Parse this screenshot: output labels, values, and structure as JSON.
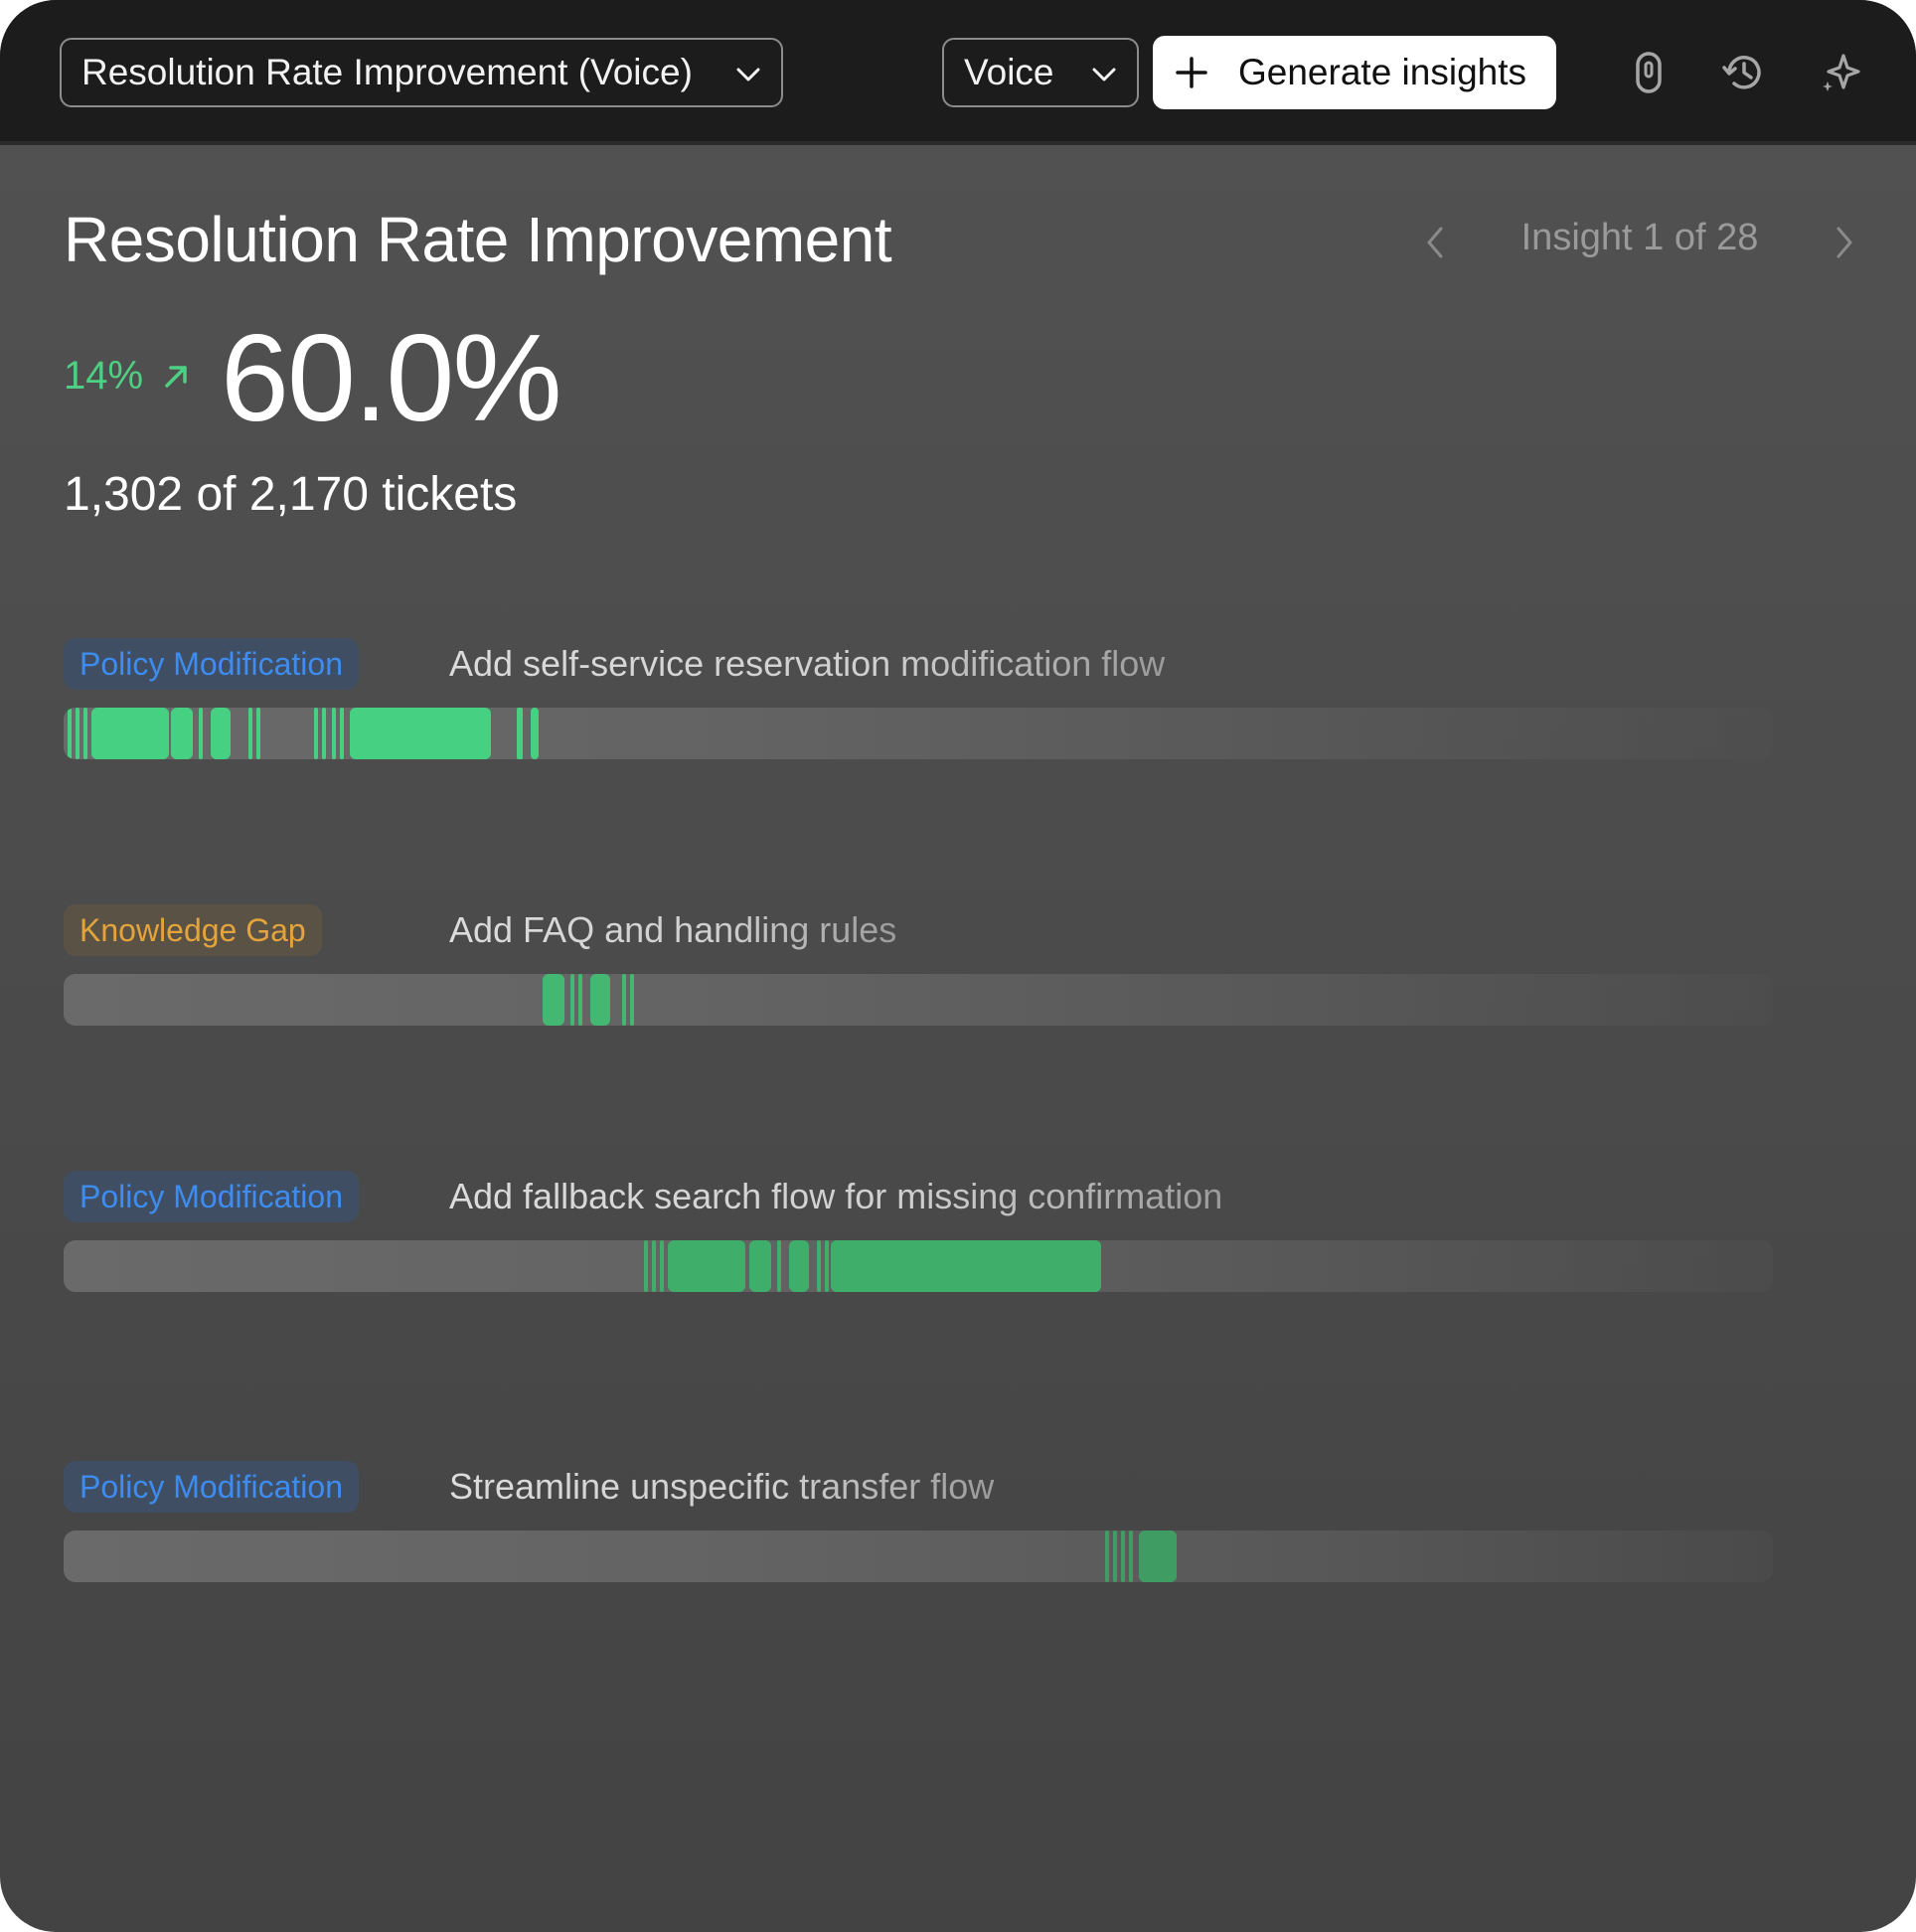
{
  "toolbar": {
    "metric_select": "Resolution Rate Improvement (Voice)",
    "channel_select": "Voice",
    "generate_label": "Generate insights",
    "icons": [
      "ai-agent-icon",
      "history-icon",
      "sparkle-icon"
    ]
  },
  "header": {
    "title": "Resolution Rate Improvement",
    "pager": "Insight 1 of 28",
    "delta": "14%",
    "value": "60.0%",
    "tickets": "1,302 of 2,170 tickets"
  },
  "colors": {
    "positive": "#4fcf84",
    "policy_tag": "#3e8cf0",
    "knowledge_tag": "#e3a43b",
    "topbar": "#1c1c1c"
  },
  "insights": [
    {
      "tag": "Policy Modification",
      "tag_type": "policy",
      "title": "Add self-service reservation modification flow"
    },
    {
      "tag": "Knowledge Gap",
      "tag_type": "knowledge",
      "title": "Add FAQ and handling rules"
    },
    {
      "tag": "Policy Modification",
      "tag_type": "policy",
      "title": "Add fallback search flow for missing confirmation"
    },
    {
      "tag": "Policy Modification",
      "tag_type": "policy",
      "title": "Streamline unspecific transfer flow"
    }
  ]
}
